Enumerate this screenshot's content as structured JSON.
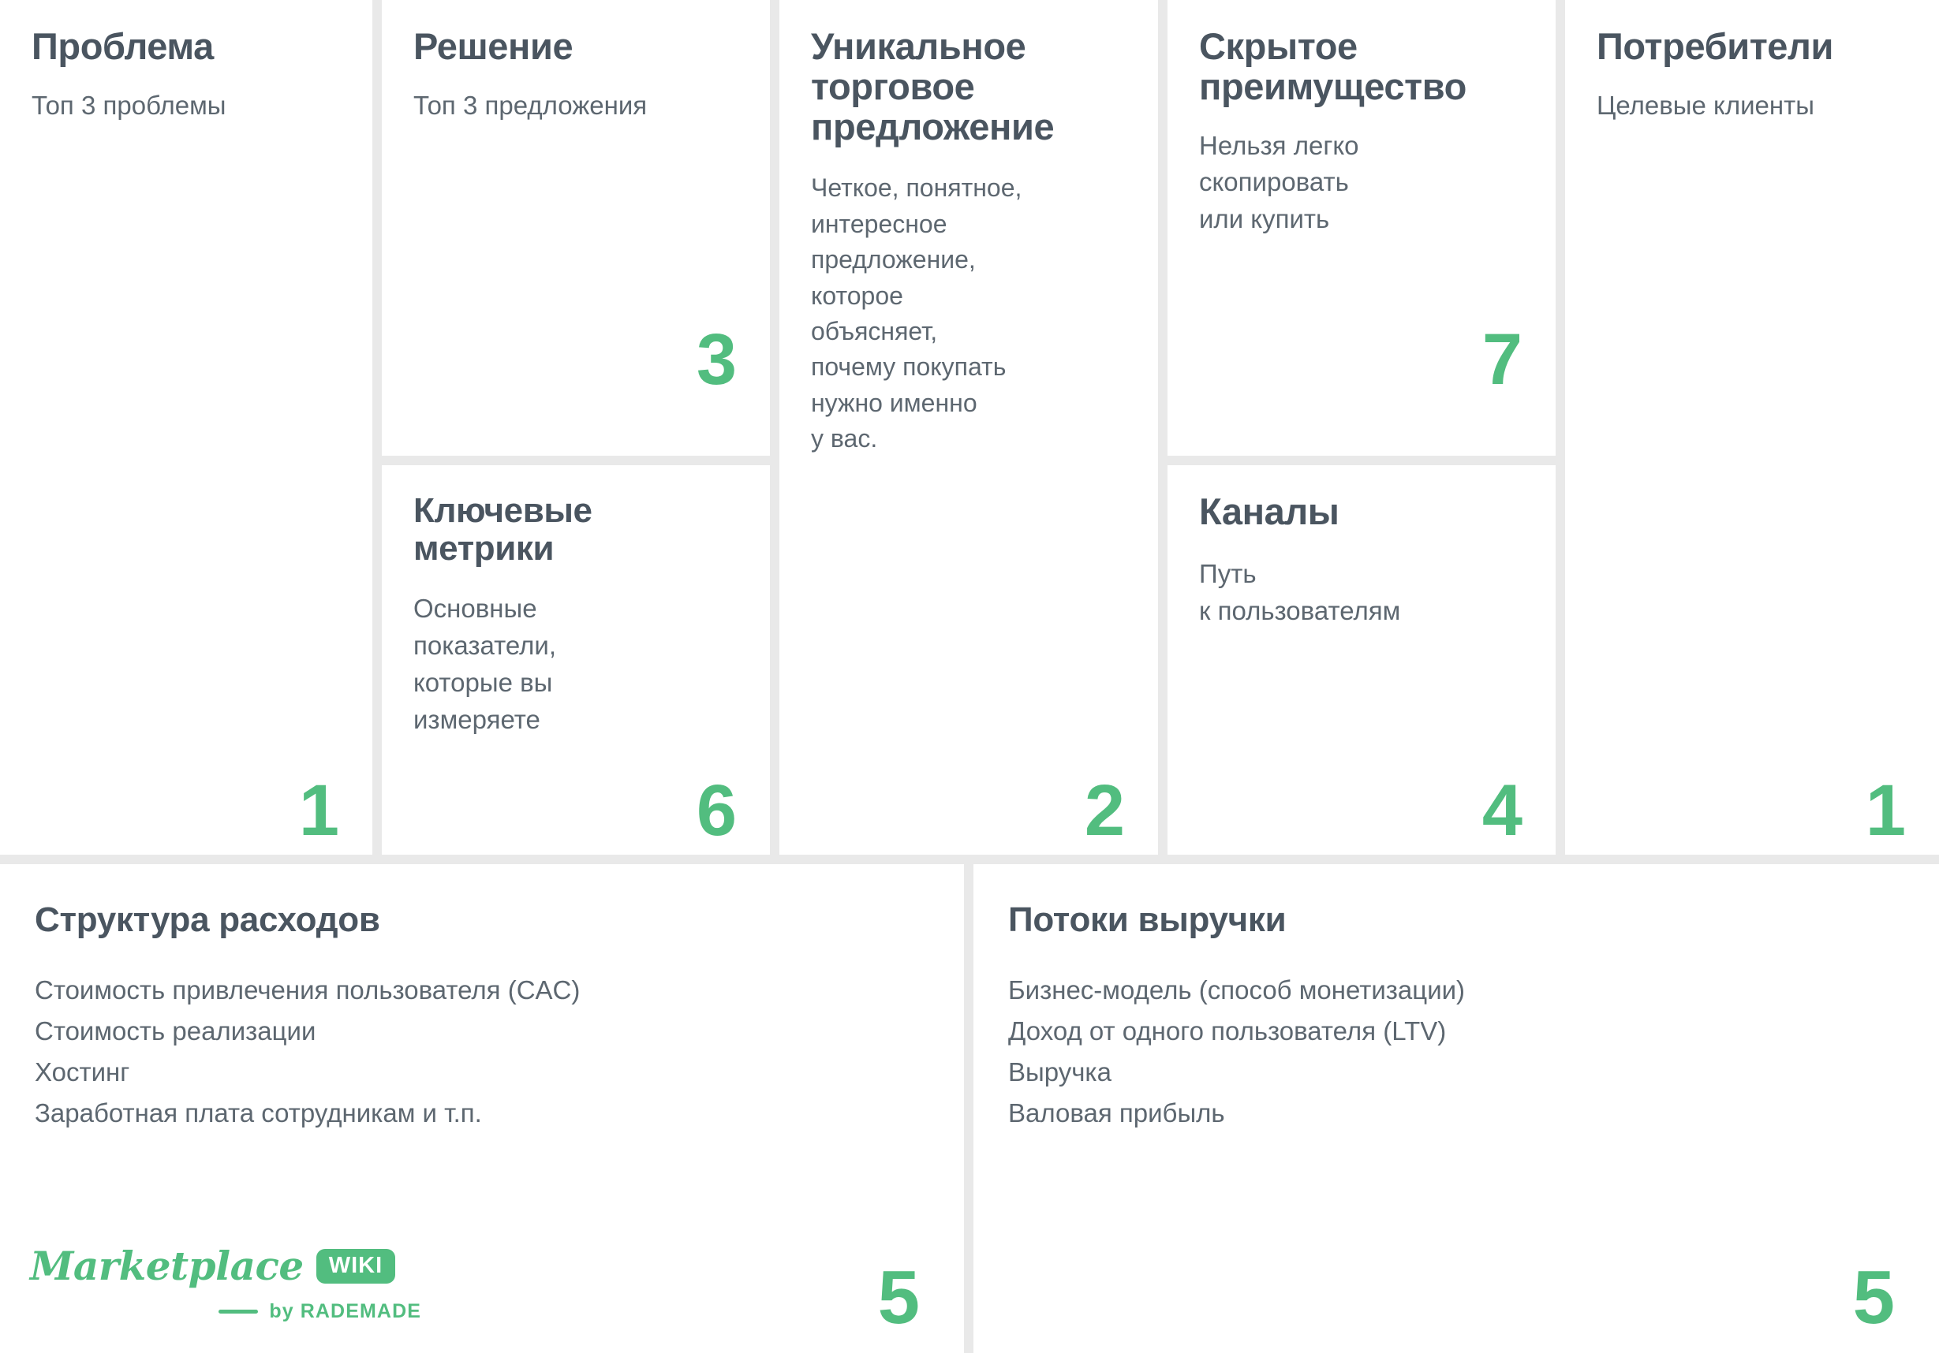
{
  "theme": {
    "accent": "#52bd7f",
    "heading": "#4a5560",
    "body_text": "#5d6770",
    "cell_bg": "#ffffff",
    "gap": "#e9e9e9"
  },
  "canvas": {
    "top_row": [
      {
        "id": "problem",
        "title": "Проблема",
        "body": "Топ 3 проблемы",
        "number": "1"
      },
      {
        "id": "solution",
        "title": "Решение",
        "body": "Топ 3\nпредложения",
        "number": "3"
      },
      {
        "id": "key-metrics",
        "title": "Ключевые\nметрики",
        "body": "Основные\nпоказатели,\nкоторые вы\nизмеряете",
        "number": "6"
      },
      {
        "id": "uvp",
        "title": "Уникальное\nторговое\nпредложение",
        "body": "Четкое, понятное,\nинтересное\nпредложение,\nкоторое\nобъясняет,\nпочему покупать\nнужно именно\nу вас.",
        "number": "2"
      },
      {
        "id": "unfair-advantage",
        "title": "Скрытое\nпреимущество",
        "body": "Нельзя легко\nскопировать\nили купить",
        "number": "7"
      },
      {
        "id": "channels",
        "title": "Каналы",
        "body": "Путь\nк пользователям",
        "number": "4"
      },
      {
        "id": "customers",
        "title": "Потребители",
        "body": "Целевые клиенты",
        "number": "1"
      }
    ],
    "bottom_row": [
      {
        "id": "cost-structure",
        "title": "Структура расходов",
        "items": [
          "Стоимость привлечения пользователя (CAC)",
          "Стоимость реализации",
          "Хостинг",
          "Заработная плата сотрудникам и т.п."
        ],
        "number": "5"
      },
      {
        "id": "revenue-streams",
        "title": "Потоки выручки",
        "items": [
          "Бизнес-модель (способ монетизации)",
          "Доход от одного пользователя (LTV)",
          "Выручка",
          "Валовая прибыль"
        ],
        "number": "5"
      }
    ]
  },
  "logo": {
    "word": "Marketplace",
    "badge": "WIKI",
    "byline": "by RADEMADE"
  }
}
